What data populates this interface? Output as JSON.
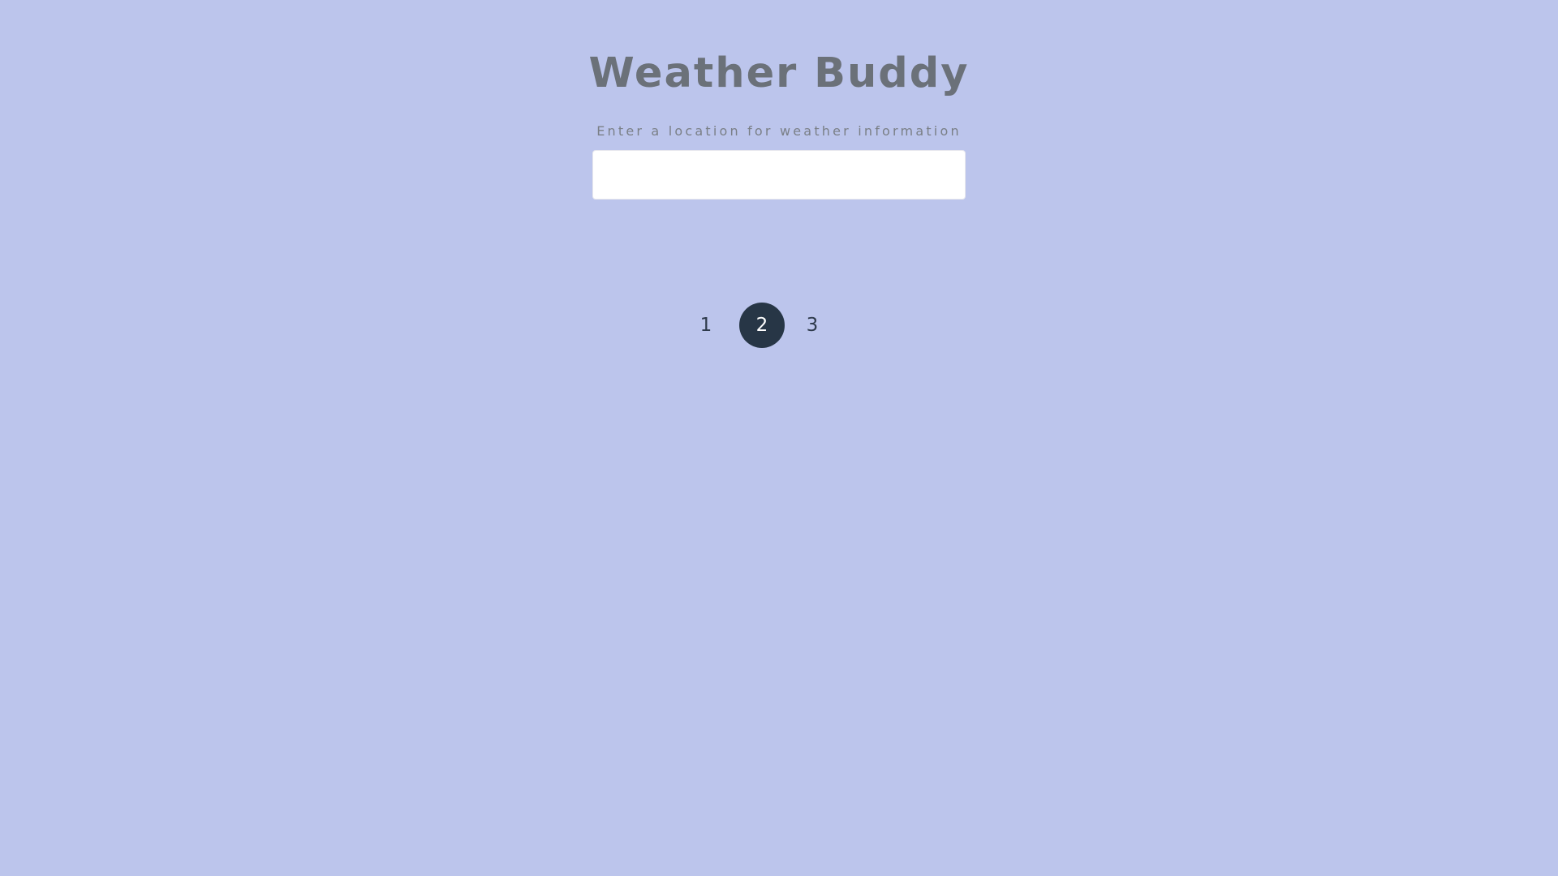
{
  "app": {
    "title": "Weather Buddy",
    "prompt": "Enter a location for weather information"
  },
  "search": {
    "value": "",
    "placeholder": ""
  },
  "pagination": {
    "pages": [
      "1",
      "2",
      "3"
    ],
    "active_page": "2"
  },
  "colors": {
    "background": "#bcc5ec",
    "title_text": "#6b7179",
    "active_page_bg": "#273646",
    "input_bg": "#ffffff"
  }
}
